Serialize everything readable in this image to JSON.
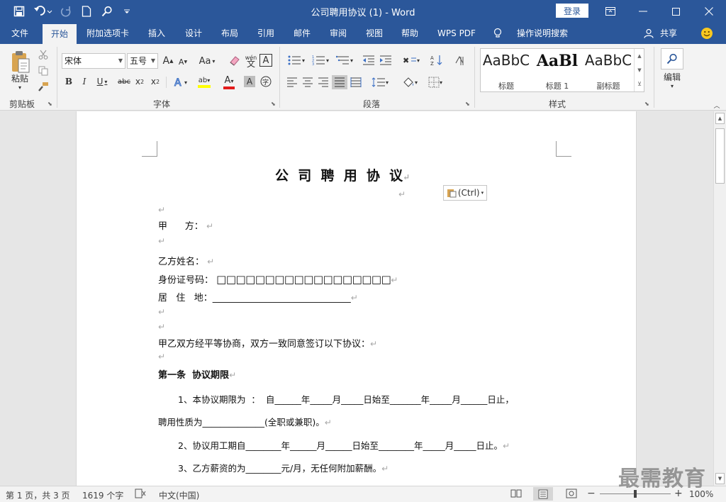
{
  "titlebar": {
    "title": "公司聘用协议 (1)  -  Word",
    "login": "登录",
    "colors": {
      "accent": "#2b579a"
    }
  },
  "tabs": [
    "文件",
    "开始",
    "附加选项卡",
    "插入",
    "设计",
    "布局",
    "引用",
    "邮件",
    "审阅",
    "视图",
    "帮助",
    "WPS PDF",
    "操作说明搜索"
  ],
  "share": "共享",
  "ribbon": {
    "clipboard": {
      "paste": "粘贴",
      "label": "剪贴板"
    },
    "font": {
      "name": "宋体",
      "size": "五号",
      "aa": "Aa",
      "phonetic": "wén",
      "label": "字体"
    },
    "paragraph": {
      "label": "段落"
    },
    "styles": {
      "label": "样式",
      "items": [
        {
          "preview": "AaBbC",
          "name": "标题"
        },
        {
          "preview": "AaBl",
          "name": "标题 1"
        },
        {
          "preview": "AaBbC",
          "name": "副标题"
        }
      ]
    },
    "editing": {
      "label": "编辑"
    }
  },
  "document": {
    "title": "公  司  聘  用  协  议",
    "paste_option": "(Ctrl)",
    "party_a": "甲      方：",
    "party_b_name": "乙方姓名：",
    "id_label": "身份证号码：",
    "id_boxes": "□□□□□□□□□□□□□□□□□□",
    "address_label": "居   住   地：",
    "address_blank": "______________________________",
    "intro": "甲乙双方经平等协商，双方一致同意签订以下协议：",
    "article1": "第一条  协议期限",
    "clause1": "1、本协议期限为  ：  自______年_____月_____日始至_______年_____月______日止，",
    "clause1b": "聘用性质为______________(全职或兼职)。",
    "clause2": "2、协议用工期自________年______月______日始至________年_____月_____日止。",
    "clause3": "3、乙方薪资的为________元/月，无任何附加薪酬。"
  },
  "status": {
    "page": "第 1 页，共 3 页",
    "words": "1619 个字",
    "lang": "中文(中国)",
    "zoom": "100%"
  },
  "watermark": "最需教育"
}
